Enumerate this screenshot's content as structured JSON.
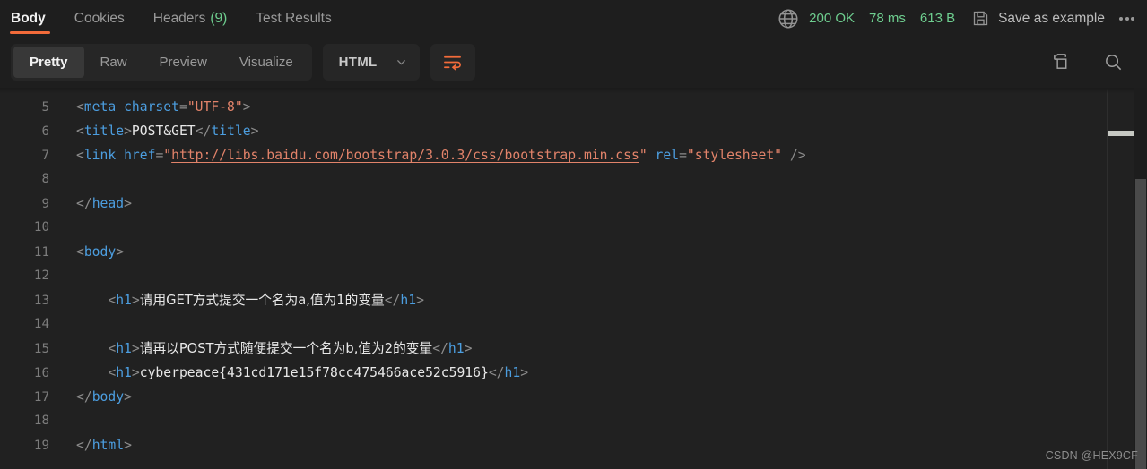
{
  "response_tabs": [
    {
      "label": "Body",
      "active": true,
      "count": ""
    },
    {
      "label": "Cookies",
      "active": false,
      "count": ""
    },
    {
      "label": "Headers",
      "active": false,
      "count": "(9)"
    },
    {
      "label": "Test Results",
      "active": false,
      "count": ""
    }
  ],
  "status": {
    "globe_icon": "globe-icon",
    "code": "200 OK",
    "time": "78 ms",
    "size": "613 B",
    "save_icon": "save-icon",
    "save_label": "Save as example",
    "more_icon": "ellipsis-icon",
    "ok_color": "#6ece8f"
  },
  "toolbar": {
    "views": [
      {
        "label": "Pretty",
        "active": true
      },
      {
        "label": "Raw",
        "active": false
      },
      {
        "label": "Preview",
        "active": false
      },
      {
        "label": "Visualize",
        "active": false
      }
    ],
    "language": "HTML",
    "language_chevron": "chevron-down-icon",
    "wrap_icon": "word-wrap-icon",
    "wrap_color": "#f26b3a",
    "copy_icon": "copy-icon",
    "search_icon": "search-icon",
    "accent_color": "#f26b3a"
  },
  "code": {
    "language": "html",
    "first_visible_line": 5,
    "lines": [
      {
        "n": "5",
        "indent": true,
        "tokens": [
          {
            "c": "p",
            "v": "<"
          },
          {
            "c": "t",
            "v": "meta"
          },
          {
            "c": "txt",
            "v": " "
          },
          {
            "c": "a",
            "v": "charset"
          },
          {
            "c": "p",
            "v": "="
          },
          {
            "c": "s",
            "v": "\"UTF-8\""
          },
          {
            "c": "p",
            "v": ">"
          }
        ]
      },
      {
        "n": "6",
        "indent": true,
        "tokens": [
          {
            "c": "p",
            "v": "<"
          },
          {
            "c": "t",
            "v": "title"
          },
          {
            "c": "p",
            "v": ">"
          },
          {
            "c": "txt",
            "v": "POST&GET"
          },
          {
            "c": "p",
            "v": "</"
          },
          {
            "c": "t",
            "v": "title"
          },
          {
            "c": "p",
            "v": ">"
          }
        ]
      },
      {
        "n": "7",
        "indent": true,
        "tokens": [
          {
            "c": "p",
            "v": "<"
          },
          {
            "c": "t",
            "v": "link"
          },
          {
            "c": "txt",
            "v": " "
          },
          {
            "c": "a",
            "v": "href"
          },
          {
            "c": "p",
            "v": "="
          },
          {
            "c": "s",
            "v": "\""
          },
          {
            "c": "url",
            "v": "http://libs.baidu.com/bootstrap/3.0.3/css/bootstrap.min.css"
          },
          {
            "c": "s",
            "v": "\""
          },
          {
            "c": "txt",
            "v": " "
          },
          {
            "c": "a",
            "v": "rel"
          },
          {
            "c": "p",
            "v": "="
          },
          {
            "c": "s",
            "v": "\"stylesheet\""
          },
          {
            "c": "txt",
            "v": " "
          },
          {
            "c": "p",
            "v": "/>"
          }
        ]
      },
      {
        "n": "8",
        "indent": true,
        "tokens": []
      },
      {
        "n": "9",
        "indent": false,
        "tokens": [
          {
            "c": "p",
            "v": "</"
          },
          {
            "c": "t",
            "v": "head"
          },
          {
            "c": "p",
            "v": ">"
          }
        ]
      },
      {
        "n": "10",
        "indent": false,
        "tokens": []
      },
      {
        "n": "11",
        "indent": false,
        "tokens": [
          {
            "c": "p",
            "v": "<"
          },
          {
            "c": "t",
            "v": "body"
          },
          {
            "c": "p",
            "v": ">"
          }
        ]
      },
      {
        "n": "12",
        "indent": true,
        "tokens": []
      },
      {
        "n": "13",
        "indent": true,
        "tokens": [
          {
            "c": "txt",
            "v": "    "
          },
          {
            "c": "p",
            "v": "<"
          },
          {
            "c": "t",
            "v": "h1"
          },
          {
            "c": "p",
            "v": ">"
          },
          {
            "c": "txt cjk",
            "v": "请用GET方式提交一个名为a,值为1的变量"
          },
          {
            "c": "p",
            "v": "</"
          },
          {
            "c": "t",
            "v": "h1"
          },
          {
            "c": "p",
            "v": ">"
          }
        ]
      },
      {
        "n": "14",
        "indent": true,
        "tokens": []
      },
      {
        "n": "15",
        "indent": true,
        "tokens": [
          {
            "c": "txt",
            "v": "    "
          },
          {
            "c": "p",
            "v": "<"
          },
          {
            "c": "t",
            "v": "h1"
          },
          {
            "c": "p",
            "v": ">"
          },
          {
            "c": "txt cjk",
            "v": "请再以POST方式随便提交一个名为b,值为2的变量"
          },
          {
            "c": "p",
            "v": "</"
          },
          {
            "c": "t",
            "v": "h1"
          },
          {
            "c": "p",
            "v": ">"
          }
        ]
      },
      {
        "n": "16",
        "indent": true,
        "tokens": [
          {
            "c": "txt",
            "v": "    "
          },
          {
            "c": "p",
            "v": "<"
          },
          {
            "c": "t",
            "v": "h1"
          },
          {
            "c": "p",
            "v": ">"
          },
          {
            "c": "txt",
            "v": "cyberpeace{431cd171e15f78cc475466ace52c5916}"
          },
          {
            "c": "p",
            "v": "</"
          },
          {
            "c": "t",
            "v": "h1"
          },
          {
            "c": "p",
            "v": ">"
          }
        ]
      },
      {
        "n": "17",
        "indent": false,
        "tokens": [
          {
            "c": "p",
            "v": "</"
          },
          {
            "c": "t",
            "v": "body"
          },
          {
            "c": "p",
            "v": ">"
          }
        ]
      },
      {
        "n": "18",
        "indent": false,
        "tokens": []
      },
      {
        "n": "19",
        "indent": false,
        "tokens": [
          {
            "c": "p",
            "v": "</"
          },
          {
            "c": "t",
            "v": "html"
          },
          {
            "c": "p",
            "v": ">"
          }
        ]
      }
    ]
  },
  "watermark": "CSDN @HEX9CF"
}
